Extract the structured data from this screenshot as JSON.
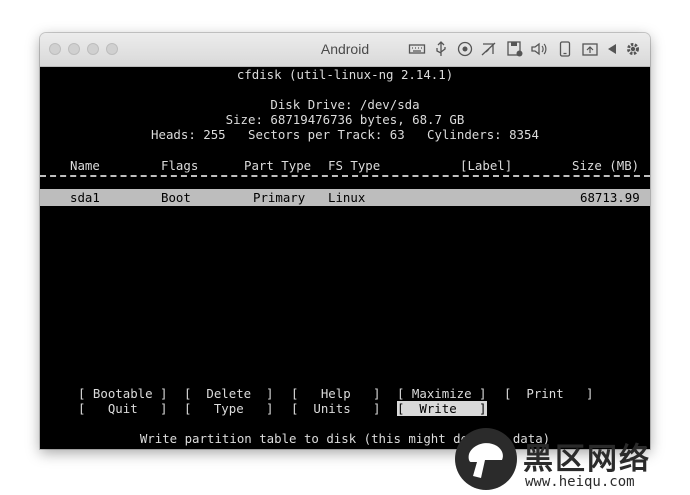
{
  "window": {
    "title": "Android"
  },
  "toolbar_icons": [
    "keyboard-icon",
    "usb-icon",
    "record-icon",
    "network-icon",
    "disk-icon",
    "volume-icon",
    "phone-icon",
    "screenshot-icon",
    "back-icon",
    "settings-icon"
  ],
  "cfdisk": {
    "app_line": "cfdisk (util-linux-ng 2.14.1)",
    "disk_drive": "Disk Drive: /dev/sda",
    "size_line": "Size: 68719476736 bytes, 68.7 GB",
    "geometry_line": "Heads: 255   Sectors per Track: 63   Cylinders: 8354",
    "columns": {
      "name": "Name",
      "flags": "Flags",
      "part_type": "Part Type",
      "fs_type": "FS Type",
      "label": "[Label]",
      "size": "Size (MB)"
    },
    "partitions": [
      {
        "name": "sda1",
        "flags": "Boot",
        "part_type": "Primary",
        "fs_type": "Linux",
        "label": "",
        "size": "68713.99"
      }
    ],
    "menu_row1": [
      "[ Bootable ]",
      "[  Delete  ]",
      "[   Help   ]",
      "[ Maximize ]",
      "[  Print   ]"
    ],
    "menu_row2": [
      "[   Quit   ]",
      "[   Type   ]",
      "[  Units   ]",
      "[  Write   ]"
    ],
    "status": "Write partition table to disk (this might destroy data)"
  },
  "watermark": {
    "chinese": "黑区网络",
    "url": "www.heiqu.com"
  }
}
